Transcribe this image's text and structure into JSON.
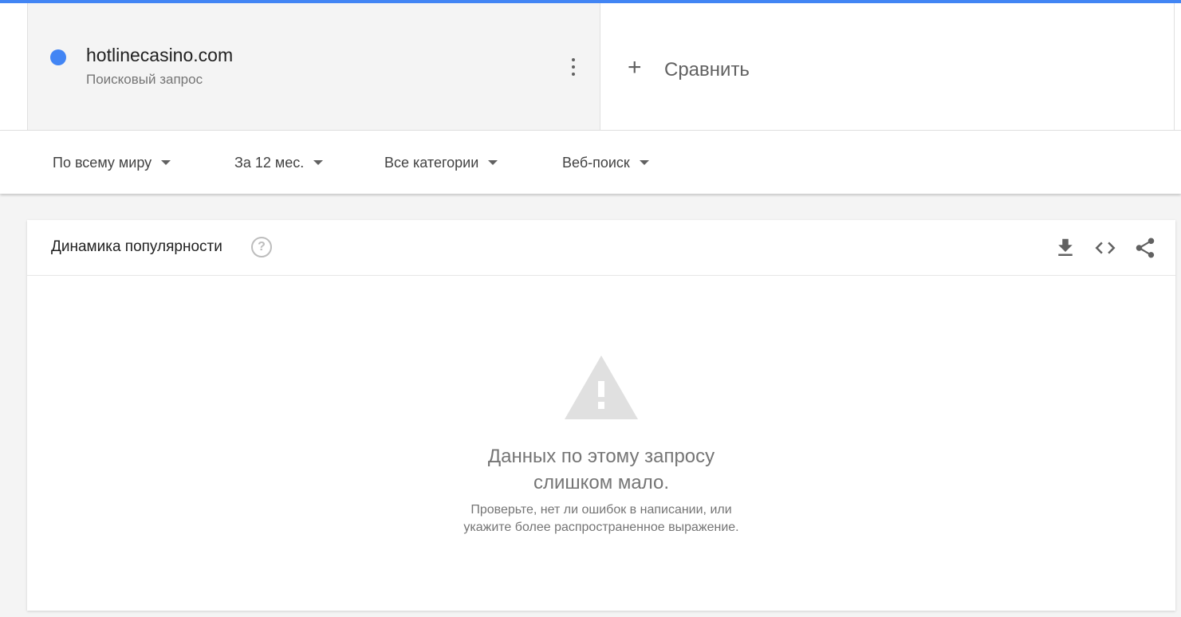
{
  "search_term": {
    "name": "hotlinecasino.com",
    "type": "Поисковый запрос",
    "color": "#4285f4"
  },
  "compare": {
    "label": "Сравнить"
  },
  "filters": {
    "region": "По всему миру",
    "period": "За 12 мес.",
    "category": "Все категории",
    "search_type": "Веб-поиск"
  },
  "widget": {
    "title": "Динамика популярности",
    "empty_title_line1": "Данных по этому запросу",
    "empty_title_line2": "слишком мало.",
    "empty_hint_line1": "Проверьте, нет ли ошибок в написании, или",
    "empty_hint_line2": "укажите более распространенное выражение."
  },
  "icons": {
    "help": "help-icon",
    "download": "download-icon",
    "embed": "embed-code-icon",
    "share": "share-icon",
    "warning": "warning-icon",
    "more": "more-vert-icon"
  }
}
